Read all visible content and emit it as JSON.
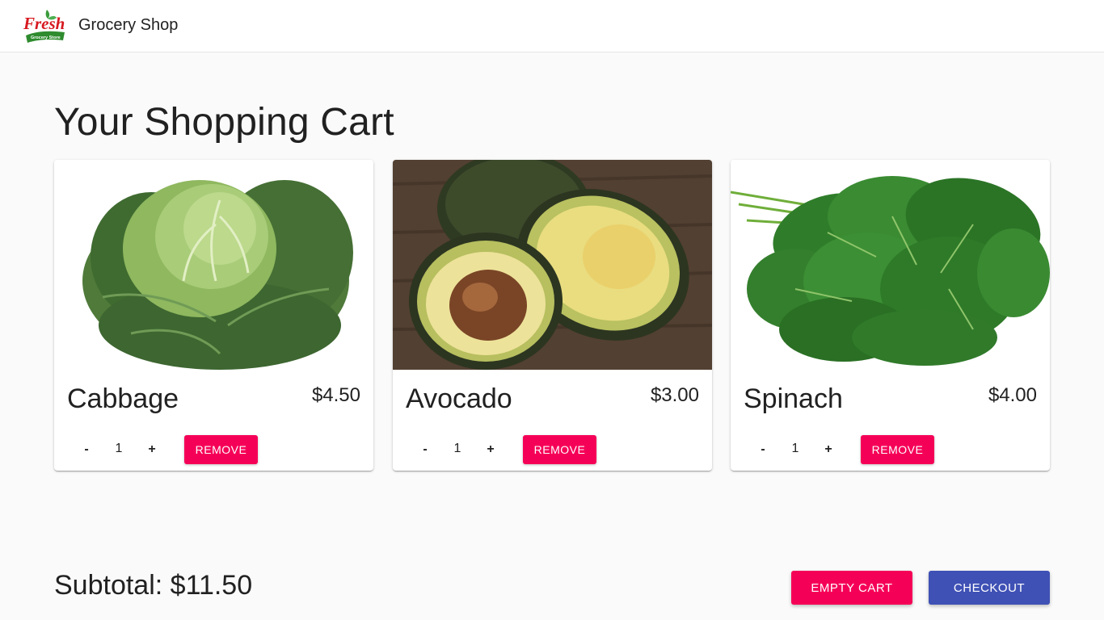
{
  "header": {
    "logo_text": "Fresh",
    "logo_subtext": "Grocery Store",
    "title": "Grocery Shop"
  },
  "page": {
    "title": "Your Shopping Cart"
  },
  "cart": {
    "items": [
      {
        "name": "Cabbage",
        "price": "$4.50",
        "quantity": "1",
        "image": "cabbage-image"
      },
      {
        "name": "Avocado",
        "price": "$3.00",
        "quantity": "1",
        "image": "avocado-image"
      },
      {
        "name": "Spinach",
        "price": "$4.00",
        "quantity": "1",
        "image": "spinach-image"
      }
    ],
    "minus_label": "-",
    "plus_label": "+",
    "remove_label": "Remove"
  },
  "footer": {
    "subtotal": "Subtotal: $11.50",
    "empty_cart_label": "Empty Cart",
    "checkout_label": "Checkout"
  },
  "colors": {
    "accent": "#f50057",
    "primary": "#3f51b5",
    "logo_red": "#d71920",
    "logo_green": "#3a9b3a"
  }
}
